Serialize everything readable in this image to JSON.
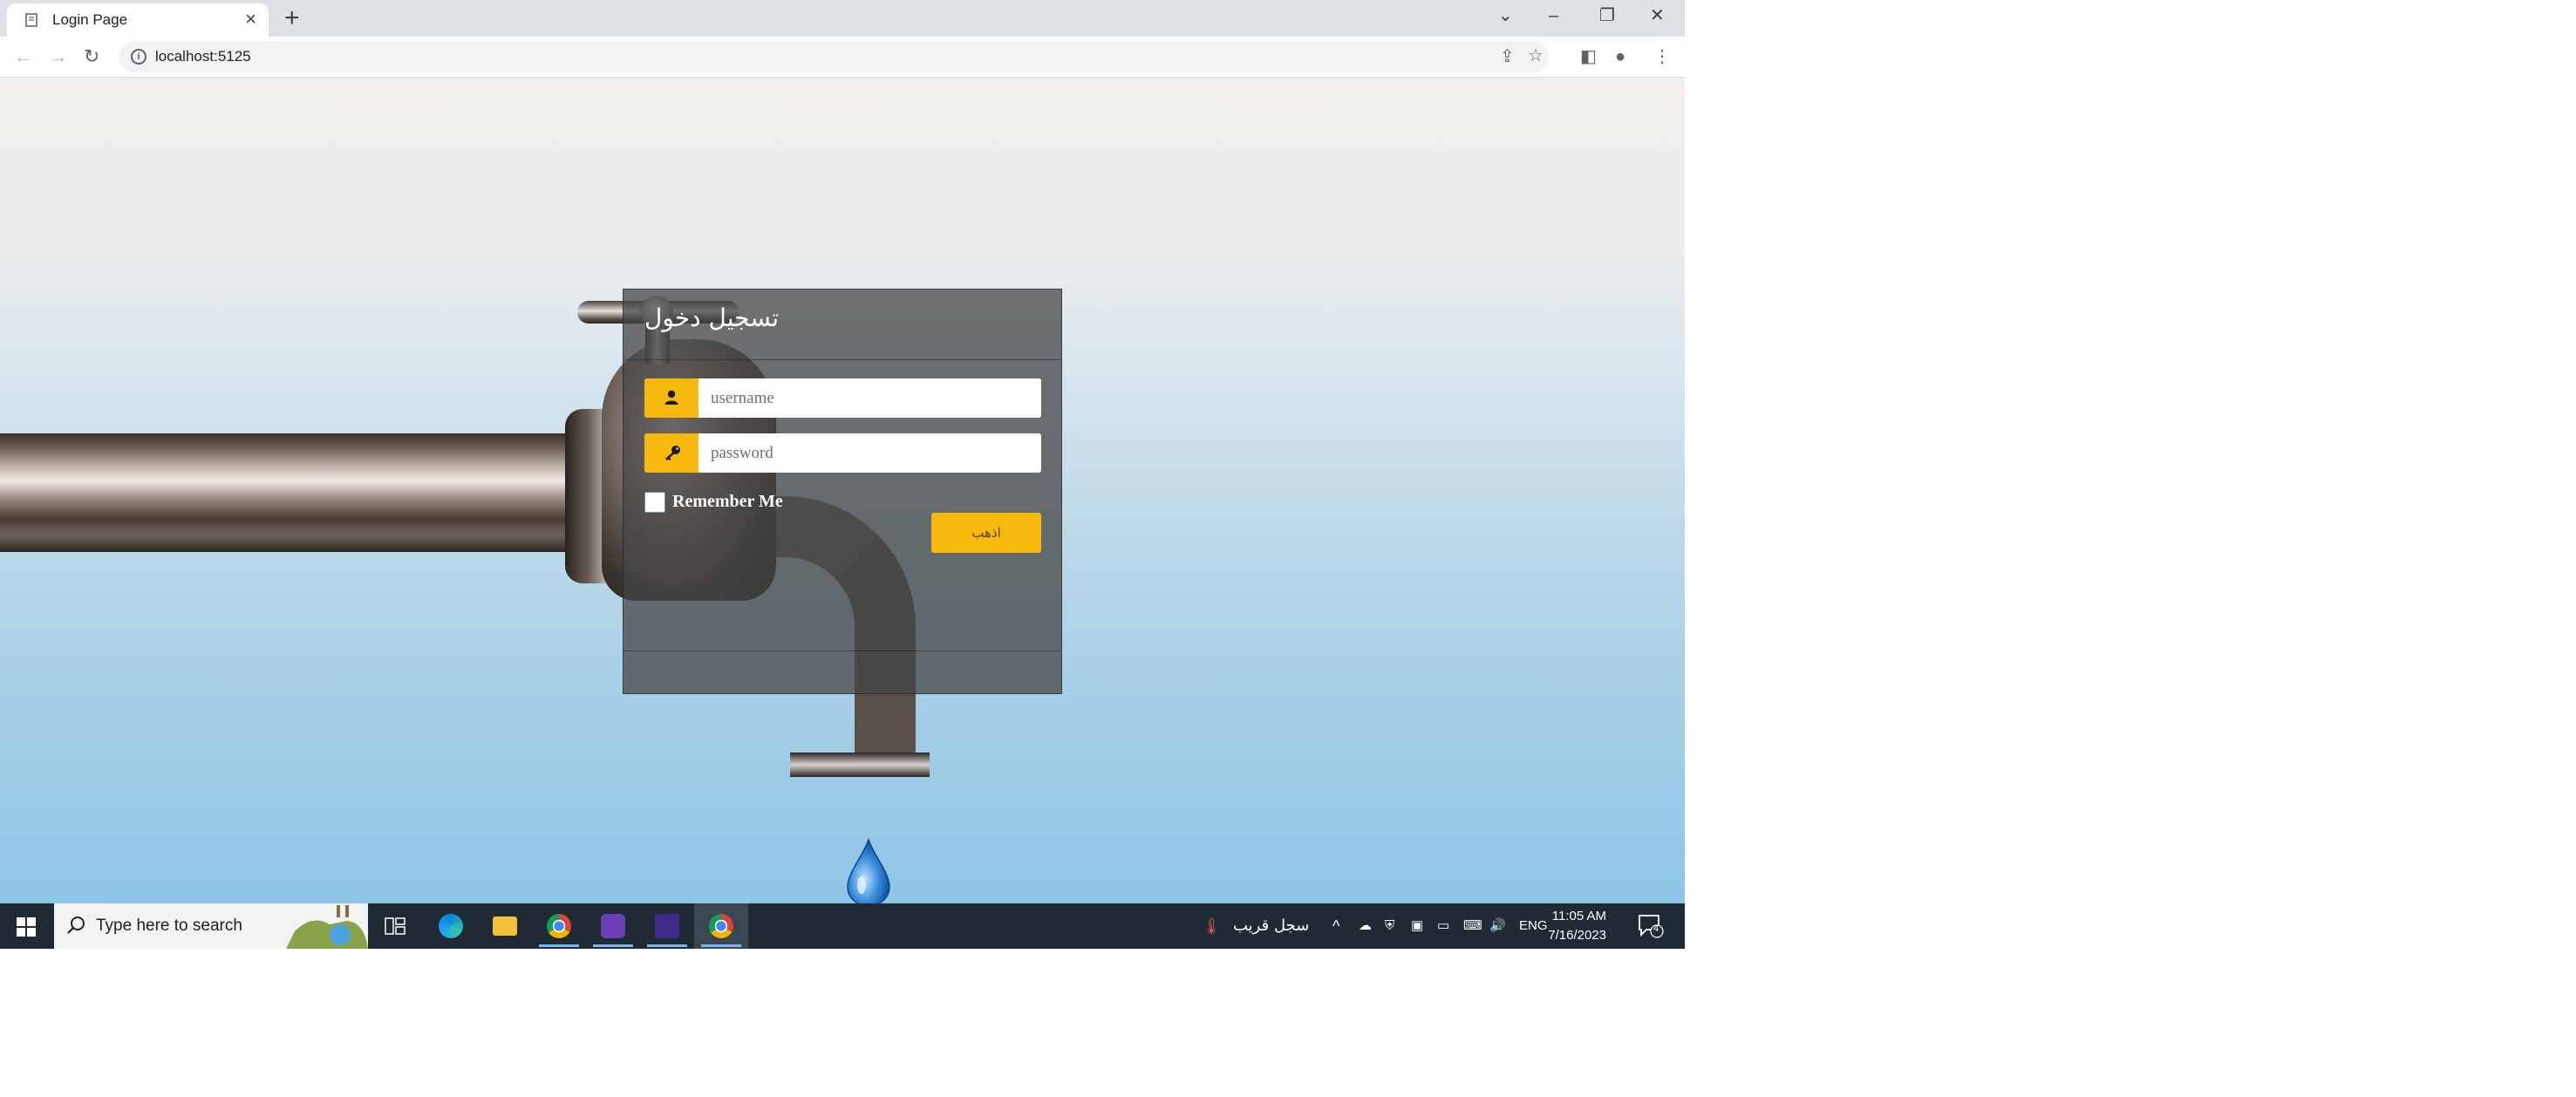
{
  "browser": {
    "tab_title": "Login Page",
    "new_tab_label": "+",
    "url": "localhost:5125"
  },
  "login": {
    "title": "تسجيل دخول",
    "username_placeholder": "username",
    "password_placeholder": "password",
    "remember_label": "Remember Me",
    "submit_label": "اذهب",
    "accent_color": "#f7b90e"
  },
  "taskbar": {
    "search_placeholder": "Type here to search",
    "weather_text": "سجل قريب",
    "language": "ENG",
    "time": "11:05 AM",
    "date": "7/16/2023",
    "notification_count": "4",
    "apps": [
      "task-view",
      "edge",
      "file-explorer",
      "chrome",
      "visual-studio",
      "terminal",
      "chrome-active"
    ]
  }
}
